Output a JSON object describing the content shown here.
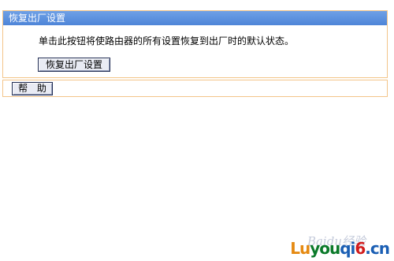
{
  "panel": {
    "title": "恢复出厂设置",
    "description": "单击此按钮将使路由器的所有设置恢复到出厂时的默认状态。",
    "reset_button_label": "恢复出厂设置"
  },
  "help": {
    "button_label": "帮 助"
  },
  "watermark": {
    "baidu_text": "Baidu经验",
    "site_part1": "Lu",
    "site_part2": "you",
    "site_part3": "qi",
    "site_part4": "6",
    "site_part5": ".cn"
  },
  "colors": {
    "header_blue": "#4e85d8",
    "panel_border": "#f3c58a",
    "button_face": "#e9ebf4"
  }
}
